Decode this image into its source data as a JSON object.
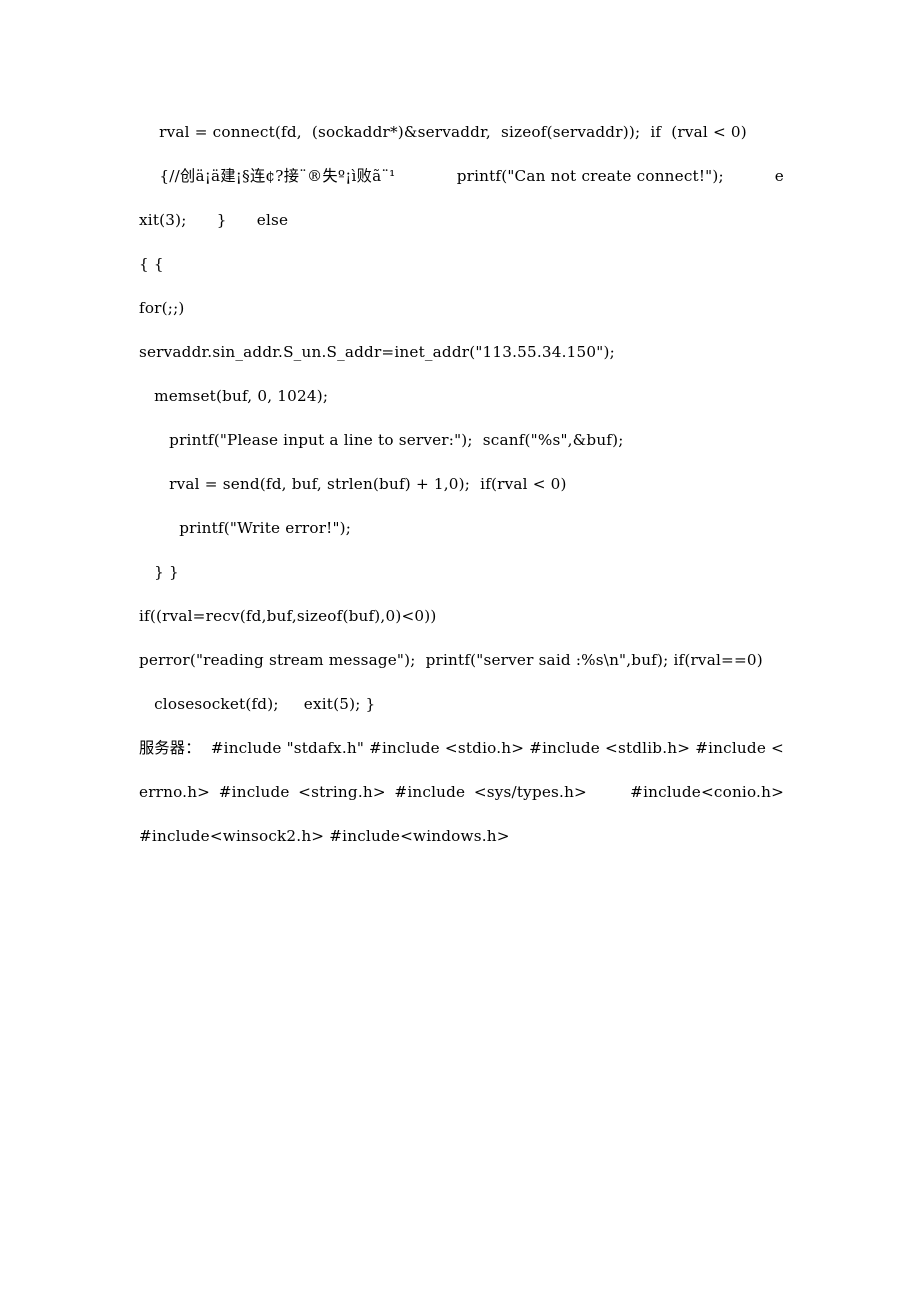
{
  "document": {
    "page_background": "#ffffff",
    "text_color": "#000000",
    "type": "code-listing",
    "blocks": [
      {
        "id": "block-connect",
        "name": "connect-call-block",
        "text": "    rval = connect(fd,  (sockaddr*)&servaddr,  sizeof(servaddr));  if  (rval < 0)"
      },
      {
        "id": "block-create-connect-fail",
        "name": "create-connect-error-block",
        "text": "    {//创ä¡ä建¡§连¢?接¨®失º¡ì败ã¨¹            printf(\"Can not create connect!\");          exit(3);      }      else"
      },
      {
        "id": "block-open-braces",
        "name": "open-braces-block",
        "text": "{ {"
      },
      {
        "id": "block-for-loop",
        "name": "for-loop-block",
        "text": "for(;;)"
      },
      {
        "id": "block-servaddr-assign",
        "name": "servaddr-inet-addr-block",
        "text": "servaddr.sin_addr.S_un.S_addr=inet_addr(\"113.55.34.150\");"
      },
      {
        "id": "block-memset",
        "name": "memset-call-block",
        "text": "   memset(buf, 0, 1024);"
      },
      {
        "id": "block-printf-please-input",
        "name": "printf-please-input-block",
        "text": "      printf(\"Please input a line to server:\");  scanf(\"%s\",&buf);"
      },
      {
        "id": "block-send",
        "name": "send-call-block",
        "text": "      rval = send(fd, buf, strlen(buf) + 1,0);  if(rval < 0)"
      },
      {
        "id": "block-printf-write-error",
        "name": "printf-write-error-block",
        "text": "        printf(\"Write error!\");"
      },
      {
        "id": "block-close-braces",
        "name": "close-braces-block",
        "text": "   } }"
      },
      {
        "id": "block-recv",
        "name": "recv-call-block",
        "text": "if((rval=recv(fd,buf,sizeof(buf),0)<0))"
      },
      {
        "id": "block-perror",
        "name": "perror-reading-stream-block",
        "text": "perror(\"reading stream message\");  printf(\"server said :%s\\n\",buf); if(rval==0)"
      },
      {
        "id": "block-closesocket",
        "name": "closesocket-block",
        "text": "   closesocket(fd);     exit(5); }"
      },
      {
        "id": "block-server-includes",
        "name": "server-includes-block",
        "text": "服务器：  #include \"stdafx.h\" #include <stdio.h> #include <stdlib.h> #include <errno.h> #include <string.h> #include <sys/types.h>     #include<conio.h>     #include<winsock2.h> #include<windows.h>"
      }
    ]
  }
}
